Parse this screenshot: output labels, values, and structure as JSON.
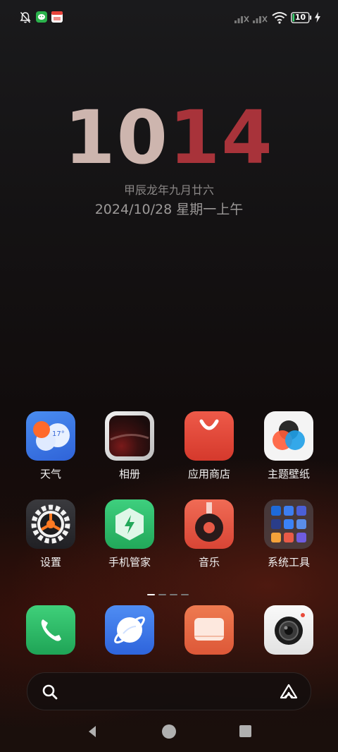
{
  "status_bar": {
    "battery_level": "10",
    "left_icons": [
      "bell-muted-icon",
      "wechat-notification-icon",
      "calendar-notification-icon"
    ],
    "right_icons": [
      "signal-sim1-icon",
      "signal-sim2-icon",
      "wifi-icon",
      "battery-icon",
      "charging-icon"
    ]
  },
  "clock": {
    "hours": "10",
    "minutes": "14",
    "hours_color": "#cdb5ae",
    "minutes_color": "#a8333a"
  },
  "lunar_date": "甲辰龙年九月廿六",
  "date_line": "2024/10/28 星期一上午",
  "apps": [
    {
      "label": "天气",
      "icon": "weather-icon",
      "temp": "17°"
    },
    {
      "label": "相册",
      "icon": "gallery-icon"
    },
    {
      "label": "应用商店",
      "icon": "app-store-icon"
    },
    {
      "label": "主题壁纸",
      "icon": "themes-icon"
    },
    {
      "label": "设置",
      "icon": "settings-icon"
    },
    {
      "label": "手机管家",
      "icon": "phone-manager-icon"
    },
    {
      "label": "音乐",
      "icon": "music-icon"
    },
    {
      "label": "系统工具",
      "icon": "system-tools-folder-icon"
    }
  ],
  "page_indicator": {
    "pages": 4,
    "current": 1
  },
  "dock": [
    {
      "icon": "phone-icon"
    },
    {
      "icon": "browser-icon"
    },
    {
      "icon": "messages-icon"
    },
    {
      "icon": "camera-icon"
    }
  ],
  "search_bar": {
    "left_icon": "search-icon",
    "right_icon": "assistant-icon"
  },
  "nav_bar": {
    "icons": [
      "back-icon",
      "home-icon",
      "recents-icon"
    ]
  }
}
